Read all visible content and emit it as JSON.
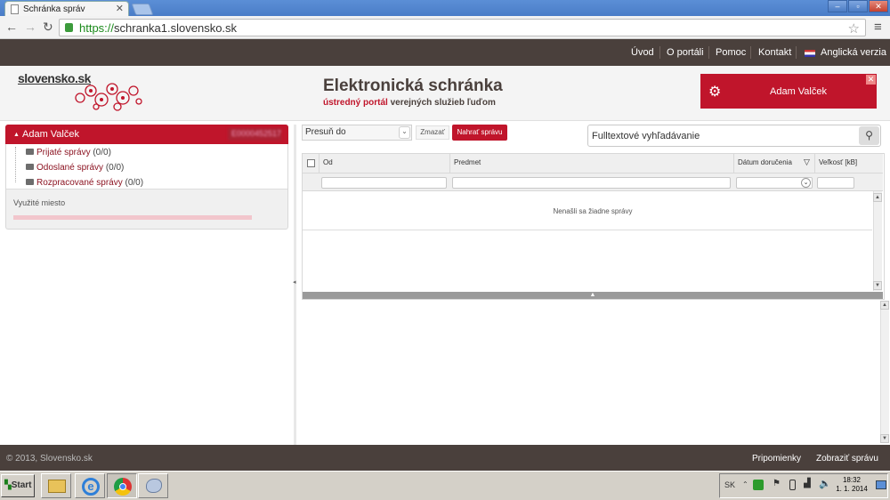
{
  "browser": {
    "tab_title": "Schránka správ",
    "url_scheme": "https://",
    "url_host": "schranka1.slovensko.sk",
    "tab_close": "✕"
  },
  "topnav": {
    "items": [
      "Úvod",
      "O portáli",
      "Pomoc",
      "Kontakt"
    ],
    "lang_label": "Anglická verzia"
  },
  "header": {
    "logo": "slovensko.sk",
    "title": "Elektronická schránka",
    "subtitle_accent": "ústredný portál",
    "subtitle_rest": " verejných služieb ľuďom",
    "user_name": "Adam Valček"
  },
  "left": {
    "user_name": "Adam Valček",
    "user_id": "E0000452517",
    "folders": [
      {
        "label": "Prijaté správy",
        "count": " (0/0)"
      },
      {
        "label": "Odoslané správy",
        "count": " (0/0)"
      },
      {
        "label": "Rozpracované správy",
        "count": " (0/0)"
      }
    ],
    "used_space_label": "Využité miesto"
  },
  "toolbar": {
    "move_to": "Presuň do",
    "delete": "Zmazať",
    "load": "Nahrať správu",
    "search_placeholder": "Fulltextové vyhľadávanie"
  },
  "grid": {
    "columns": [
      "Od",
      "Predmet",
      "Dátum doručenia",
      "Veľkosť [kB]"
    ],
    "empty_text": "Nenašli sa žiadne správy"
  },
  "footer": {
    "copyright": "© 2013, Slovensko.sk",
    "links": [
      "Pripomienky",
      "Zobraziť správu"
    ]
  },
  "taskbar": {
    "start": "Start",
    "lang": "SK",
    "time": "18:32",
    "date": "1. 1. 2014"
  },
  "colors": {
    "brand_red": "#c0152b",
    "dark_brown": "#4a403c"
  }
}
